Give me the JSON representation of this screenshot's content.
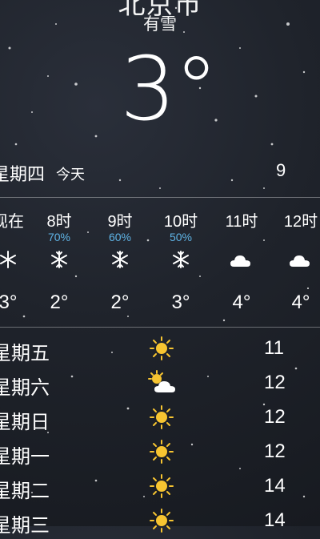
{
  "header": {
    "city_partial": "北京市",
    "condition": "有雪",
    "temperature": "3°"
  },
  "today": {
    "day": "星期四",
    "label": "今天",
    "high": "9"
  },
  "hourly": [
    {
      "time": "现在",
      "prob": "",
      "icon": "snowflake-icon",
      "temp": "3°"
    },
    {
      "time": "8时",
      "prob": "70%",
      "icon": "snowflake-icon",
      "temp": "2°"
    },
    {
      "time": "9时",
      "prob": "60%",
      "icon": "snowflake-icon",
      "temp": "2°"
    },
    {
      "time": "10时",
      "prob": "50%",
      "icon": "snowflake-icon",
      "temp": "3°"
    },
    {
      "time": "11时",
      "prob": "",
      "icon": "cloud-icon",
      "temp": "4°"
    },
    {
      "time": "12时",
      "prob": "",
      "icon": "cloud-icon",
      "temp": "4°"
    }
  ],
  "daily": [
    {
      "day": "星期五",
      "icon": "sun-icon",
      "high": "11"
    },
    {
      "day": "星期六",
      "icon": "partly-cloudy-icon",
      "high": "12"
    },
    {
      "day": "星期日",
      "icon": "sun-icon",
      "high": "12"
    },
    {
      "day": "星期一",
      "icon": "sun-icon",
      "high": "12"
    },
    {
      "day": "星期二",
      "icon": "sun-icon",
      "high": "14"
    },
    {
      "day": "星期三",
      "icon": "sun-icon",
      "high": "14"
    }
  ],
  "colors": {
    "precip_blue": "#5fb4e6",
    "sun_yellow": "#f7c531",
    "background": "#1f232b"
  }
}
